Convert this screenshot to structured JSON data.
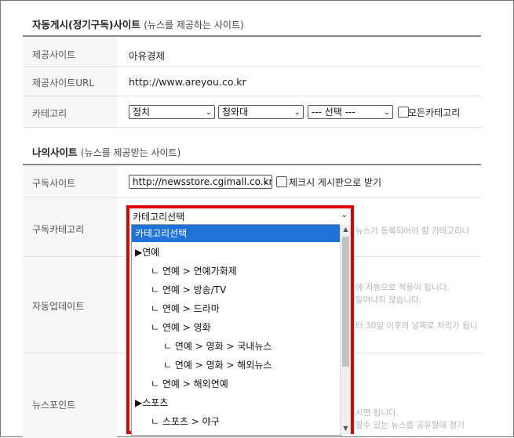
{
  "sections": {
    "provider": {
      "title": "자동게시(정기구독)사이트",
      "subtitle": "(뉴스를 제공하는 사이트)"
    },
    "mine": {
      "title": "나의사이트",
      "subtitle": "(뉴스를 제공받는 사이트)"
    }
  },
  "provider_rows": {
    "site_label": "제공사이트",
    "site_value": "아유경제",
    "url_label": "제공사이트URL",
    "url_value": "http://www.areyou.co.kr",
    "category_label": "카테고리",
    "cat1": "정치",
    "cat2": "청와대",
    "cat3": "--- 선택 ---",
    "all_categories_label": "모든카테고리"
  },
  "mine_rows": {
    "sub_site_label": "구독사이트",
    "sub_site_value": "http://newsstore.cgimall.co.kr",
    "check_board_label": "체크시 게시판으로 받기",
    "sub_category_label": "구독카테고리",
    "auto_update_label": "자동업데이트",
    "news_point_label": "뉴스포인트"
  },
  "background_texts": {
    "t1": "뉴스가 등록되어야 할 카테고리나",
    "t2": "에 자동으로 적용이 됩니다.",
    "t3": "일어나지 않습니다.",
    "t4": "터 30일 이후의 날짜로 처리가 됩니",
    "t5": "시면 됩니다.",
    "t6": "할수 있는 뉴스를 공유할때 정기"
  },
  "dropdown": {
    "selected": "카테고리선택",
    "options": [
      "카테고리선택",
      "▶연예",
      "ㄴ 연예 > 연예가화제",
      "ㄴ 연예 > 방송/TV",
      "ㄴ 연예 > 드라마",
      "ㄴ 연예 > 영화",
      "ㄴ 연예 > 영화 > 국내뉴스",
      "ㄴ 연예 > 영화 > 해외뉴스",
      "ㄴ 연예 > 해외연예",
      "▶스포츠",
      "ㄴ 스포츠 > 야구"
    ]
  },
  "colors": {
    "highlight": "#1e73d8",
    "outline": "#e30000"
  }
}
